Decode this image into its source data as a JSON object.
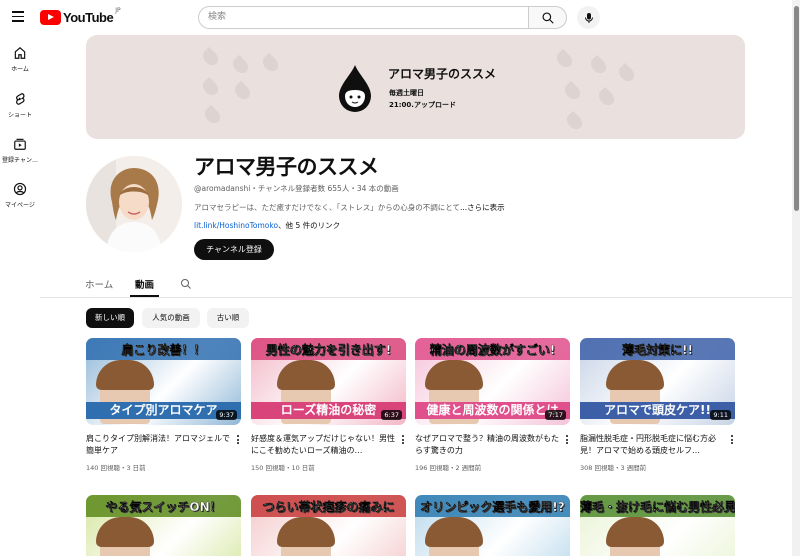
{
  "header": {
    "logo_text": "YouTube",
    "logo_region": "JP",
    "search_placeholder": "検索"
  },
  "sidebar": {
    "items": [
      {
        "label": "ホーム",
        "icon": "home-icon"
      },
      {
        "label": "ショート",
        "icon": "shorts-icon"
      },
      {
        "label": "登録チャン…",
        "icon": "subscriptions-icon"
      },
      {
        "label": "マイページ",
        "icon": "account-icon"
      }
    ]
  },
  "banner": {
    "title": "アロマ男子のススメ",
    "schedule_day": "毎週土曜日",
    "schedule_time": "21:00.アップロード"
  },
  "channel": {
    "name": "アロマ男子のススメ",
    "meta": "@aromadanshi・チャンネル登録者数 655人・34 本の動画",
    "description": "アロマセラピーは、ただ癒すだけでなく、「ストレス」からの心身の不調にとて",
    "more_label": "...さらに表示",
    "link": "lit.link/HoshinoTomoko",
    "link_suffix": "、他 5 件のリンク",
    "subscribe_label": "チャンネル登録"
  },
  "tabs": [
    {
      "label": "ホーム"
    },
    {
      "label": "動画"
    }
  ],
  "chips": [
    {
      "label": "新しい順"
    },
    {
      "label": "人気の動画"
    },
    {
      "label": "古い順"
    }
  ],
  "videos": [
    {
      "thumb_title": "肩こり改善！！",
      "thumb_bottom": "タイプ別アロマケア",
      "duration": "9:37",
      "title": "肩こりタイプ別解消法！アロマジェルで簡単ケア",
      "meta": "140 回視聴・3 日前",
      "colors": [
        "#8fb7d8",
        "#2f6fb0"
      ]
    },
    {
      "thumb_title": "男性の魅力を引き出す!",
      "thumb_bottom": "ローズ精油の秘密",
      "duration": "6:37",
      "title": "好感度＆運気アップだけじゃない！男性にこそ勧めたいローズ精油の…",
      "meta": "150 回視聴・10 日前",
      "colors": [
        "#f2b6c6",
        "#d9447a"
      ]
    },
    {
      "thumb_title": "精油の周波数がすごい!",
      "thumb_bottom": "健康と周波数の関係とは",
      "duration": "7:17",
      "title": "なぜアロマで整う？精油の周波数がもたらす驚きの力",
      "meta": "196 回視聴・2 週間前",
      "colors": [
        "#f5c2d8",
        "#e0508c"
      ]
    },
    {
      "thumb_title": "薄毛対策に!!",
      "thumb_bottom": "アロマで頭皮ケア!!",
      "duration": "9:11",
      "title": "脂漏性脱毛症・円形脱毛症に悩む方必見！アロマで始める頭皮セルフ…",
      "meta": "308 回視聴・3 週間前",
      "colors": [
        "#c6d3e6",
        "#3c5fa8"
      ]
    },
    {
      "thumb_title": "やる気スイッチON！",
      "thumb_bottom": "",
      "duration": "",
      "title": "",
      "meta": "",
      "colors": [
        "#d6e6a0",
        "#5c8a1c"
      ]
    },
    {
      "thumb_title": "つらい帯状疱疹の痛みに",
      "thumb_bottom": "",
      "duration": "",
      "title": "",
      "meta": "",
      "colors": [
        "#f4c8c8",
        "#c83a3a"
      ]
    },
    {
      "thumb_title": "オリンピック選手も愛用!?",
      "thumb_bottom": "",
      "duration": "",
      "title": "",
      "meta": "",
      "colors": [
        "#b9d9ec",
        "#2a7ab0"
      ]
    },
    {
      "thumb_title": "薄毛・抜け毛に悩む男性必見",
      "thumb_bottom": "",
      "duration": "",
      "title": "",
      "meta": "",
      "colors": [
        "#e9f3d4",
        "#4f8a2a"
      ]
    }
  ]
}
